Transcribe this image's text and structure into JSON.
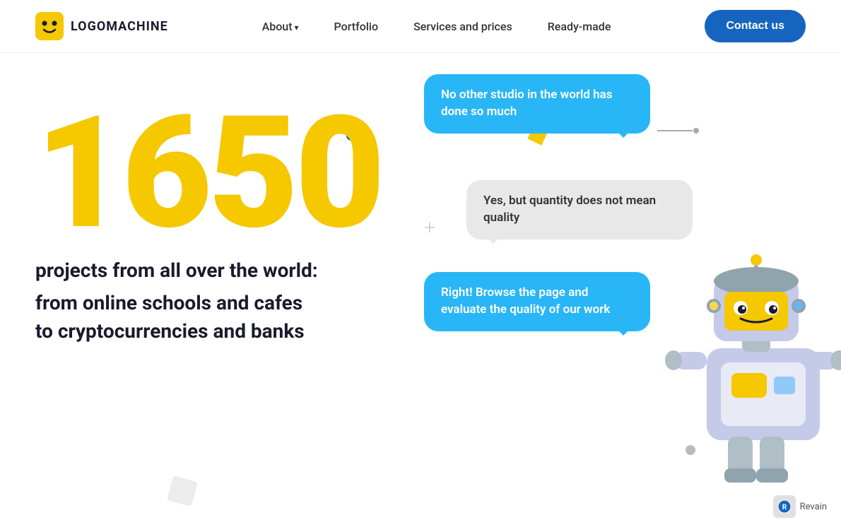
{
  "navbar": {
    "logo_text": "LOGOMACHINE",
    "links": [
      {
        "label": "About",
        "has_arrow": true,
        "id": "about"
      },
      {
        "label": "Portfolio",
        "has_arrow": false,
        "id": "portfolio"
      },
      {
        "label": "Services and prices",
        "has_arrow": false,
        "id": "services"
      },
      {
        "label": "Ready-made",
        "has_arrow": false,
        "id": "readymade"
      }
    ],
    "contact_button": "Contact us"
  },
  "hero": {
    "big_number": "1650",
    "subtitle": "projects from all over the world:",
    "description": "from online schools and cafes\nto cryptocurrencies and banks"
  },
  "chat_bubbles": [
    {
      "id": "bubble1",
      "text": "No other studio in the world has done so much",
      "style": "blue"
    },
    {
      "id": "bubble2",
      "text": "Yes, but quantity does not mean quality",
      "style": "gray"
    },
    {
      "id": "bubble3",
      "text": "Right! Browse the page and evaluate the quality of our work",
      "style": "blue"
    }
  ],
  "revain": {
    "label": "Revain"
  },
  "decorations": {
    "blue_dot": "●",
    "yellow_square": "■",
    "plus": "+",
    "gray_dot": "●"
  }
}
